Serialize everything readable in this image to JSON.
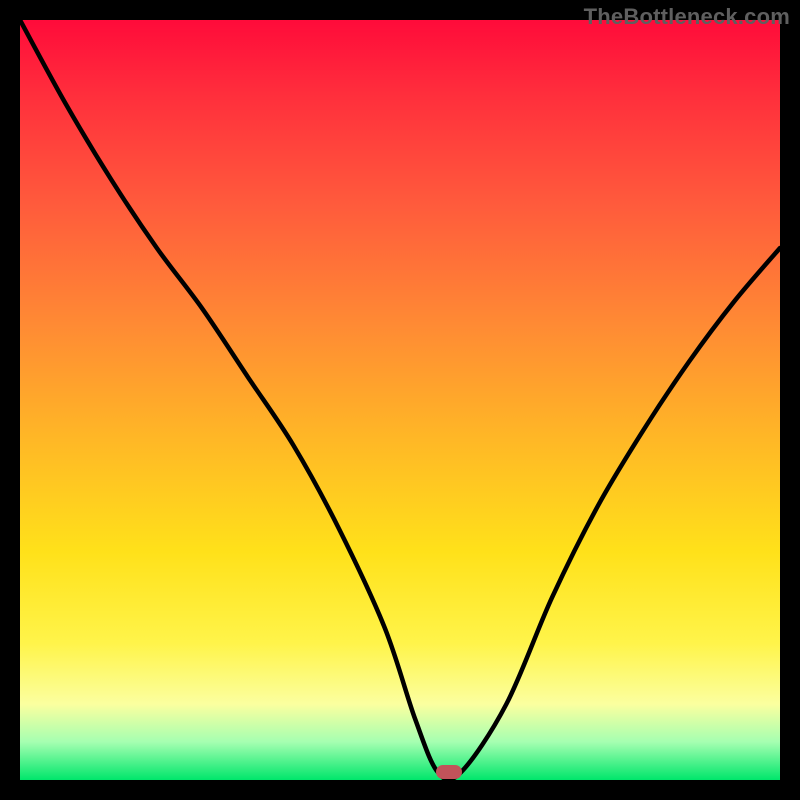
{
  "watermark": "TheBottleneck.com",
  "chart_data": {
    "type": "line",
    "title": "",
    "xlabel": "",
    "ylabel": "",
    "xlim": [
      0,
      100
    ],
    "ylim": [
      0,
      100
    ],
    "series": [
      {
        "name": "bottleneck-curve",
        "x": [
          0,
          6,
          12,
          18,
          24,
          30,
          36,
          42,
          48,
          52,
          55,
          58,
          64,
          70,
          76,
          82,
          88,
          94,
          100
        ],
        "values": [
          100,
          89,
          79,
          70,
          62,
          53,
          44,
          33,
          20,
          8,
          1,
          1,
          10,
          24,
          36,
          46,
          55,
          63,
          70
        ]
      }
    ],
    "annotations": [
      {
        "name": "optimal-marker",
        "x": 56.5,
        "y": 1
      }
    ],
    "background_gradient": {
      "stops": [
        {
          "pos": 0,
          "color": "#ff0b3a"
        },
        {
          "pos": 10,
          "color": "#ff2f3c"
        },
        {
          "pos": 24,
          "color": "#ff5a3c"
        },
        {
          "pos": 40,
          "color": "#ff8a34"
        },
        {
          "pos": 55,
          "color": "#ffb726"
        },
        {
          "pos": 70,
          "color": "#ffe11a"
        },
        {
          "pos": 82,
          "color": "#fff44a"
        },
        {
          "pos": 90,
          "color": "#fbff9f"
        },
        {
          "pos": 95,
          "color": "#a5ffb1"
        },
        {
          "pos": 100,
          "color": "#00e66b"
        }
      ]
    }
  }
}
